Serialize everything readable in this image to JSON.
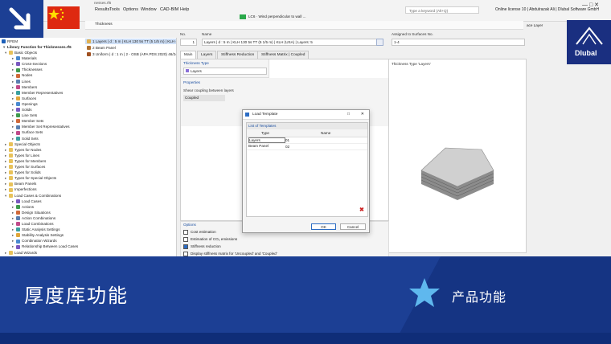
{
  "menubar": {
    "items": [
      "Results",
      "Tools",
      "Options",
      "Window",
      "CAD-BIM",
      "Help"
    ],
    "file_name": "nesses.rf6",
    "load_combo": "LC6 · Wind perpendicular to wall ...",
    "search_placeholder": "Type a keyword (Alt+Q)",
    "license": "Online license 10 | Abdulrazak Ali | Dlubal Software GmbH",
    "window_label": "Thickness",
    "surface_layer_label": "ace Layer"
  },
  "navigator": {
    "title": "RFEM",
    "file": "Library Function for Thicknesses.rf6",
    "items": [
      {
        "label": "Basic Objects",
        "level": 1,
        "open": true
      },
      {
        "label": "Materials",
        "level": 2
      },
      {
        "label": "Cross-Sections",
        "level": 2
      },
      {
        "label": "Thicknesses",
        "level": 2
      },
      {
        "label": "Nodes",
        "level": 2
      },
      {
        "label": "Lines",
        "level": 2
      },
      {
        "label": "Members",
        "level": 2
      },
      {
        "label": "Member Representatives",
        "level": 2
      },
      {
        "label": "Surfaces",
        "level": 2
      },
      {
        "label": "Openings",
        "level": 2
      },
      {
        "label": "Solids",
        "level": 2
      },
      {
        "label": "Line Sets",
        "level": 2
      },
      {
        "label": "Member Sets",
        "level": 2
      },
      {
        "label": "Member Set Representatives",
        "level": 2
      },
      {
        "label": "Surface Sets",
        "level": 2
      },
      {
        "label": "Solid Sets",
        "level": 2
      },
      {
        "label": "Special Objects",
        "level": 1
      },
      {
        "label": "Types for Nodes",
        "level": 1
      },
      {
        "label": "Types for Lines",
        "level": 1
      },
      {
        "label": "Types for Members",
        "level": 1
      },
      {
        "label": "Types for Surfaces",
        "level": 1
      },
      {
        "label": "Types for Solids",
        "level": 1
      },
      {
        "label": "Types for Special Objects",
        "level": 1
      },
      {
        "label": "Beam Panels",
        "level": 1
      },
      {
        "label": "Imperfections",
        "level": 1
      },
      {
        "label": "Load Cases & Combinations",
        "level": 1,
        "open": true
      },
      {
        "label": "Load Cases",
        "level": 2
      },
      {
        "label": "Actions",
        "level": 2
      },
      {
        "label": "Design Situations",
        "level": 2
      },
      {
        "label": "Action Combinations",
        "level": 2
      },
      {
        "label": "Load Combinations",
        "level": 2
      },
      {
        "label": "Static Analysis Settings",
        "level": 2
      },
      {
        "label": "Stability Analysis Settings",
        "level": 2
      },
      {
        "label": "Combination Wizards",
        "level": 2
      },
      {
        "label": "Relationship Between Load Cases",
        "level": 2
      },
      {
        "label": "Load Wizards",
        "level": 1
      }
    ]
  },
  "thickness_list": [
    {
      "text": "1  Layers | d : 5 m | KLH 130 5s TT (5 1/5 m) | KLH (US",
      "color": "#e0b050",
      "selected": true
    },
    {
      "text": "2  Beam Panel",
      "color": "#b07030",
      "selected": false
    },
    {
      "text": "3  Uniform | d : 1 m | 2 - OSB (APA PDS 2020) 46/24",
      "color": "#a05020",
      "selected": false
    }
  ],
  "header": {
    "no_label": "No.",
    "no_value": "1",
    "name_label": "Name",
    "name_value": "Layers | d : 5 m | KLH 130 5s TT (5 1/5 m) | KLH (USA) | Layers: 5",
    "assigned_label": "Assigned to Surfaces No.",
    "assigned_value": "1-4"
  },
  "tabs": [
    "Main",
    "Layers",
    "Stiffness Reduction",
    "Stiffness Matrix | Coupled"
  ],
  "thickness_type": {
    "label": "Thickness Type",
    "value": "Layers",
    "preview_label": "Thickness Type  'Layers'"
  },
  "properties": {
    "label": "Properties",
    "shear_label": "Shear coupling between layers",
    "shear_value": "Coupled"
  },
  "options": {
    "label": "Options",
    "items": [
      {
        "label": "Cost estimation",
        "checked": false
      },
      {
        "label": "Estimation of CO₂ emissions",
        "checked": false
      },
      {
        "label": "Stiffness reduction",
        "checked": true
      },
      {
        "label": "Display stiffness matrix for 'Uncoupled' and 'Coupled'",
        "checked": false
      }
    ]
  },
  "modal": {
    "title": "Load Template",
    "list_label": "List of Templates",
    "col_type": "Type",
    "col_name": "Name",
    "rows": [
      {
        "type": "Layers",
        "name": "01"
      },
      {
        "type": "Beam Panel",
        "name": "02"
      }
    ],
    "ok": "OK",
    "cancel": "Cancel"
  },
  "brand": {
    "logo": "Dlubal",
    "accent": "#1c3f94"
  },
  "banner": {
    "title": "厚度库功能",
    "right": "产品功能"
  }
}
